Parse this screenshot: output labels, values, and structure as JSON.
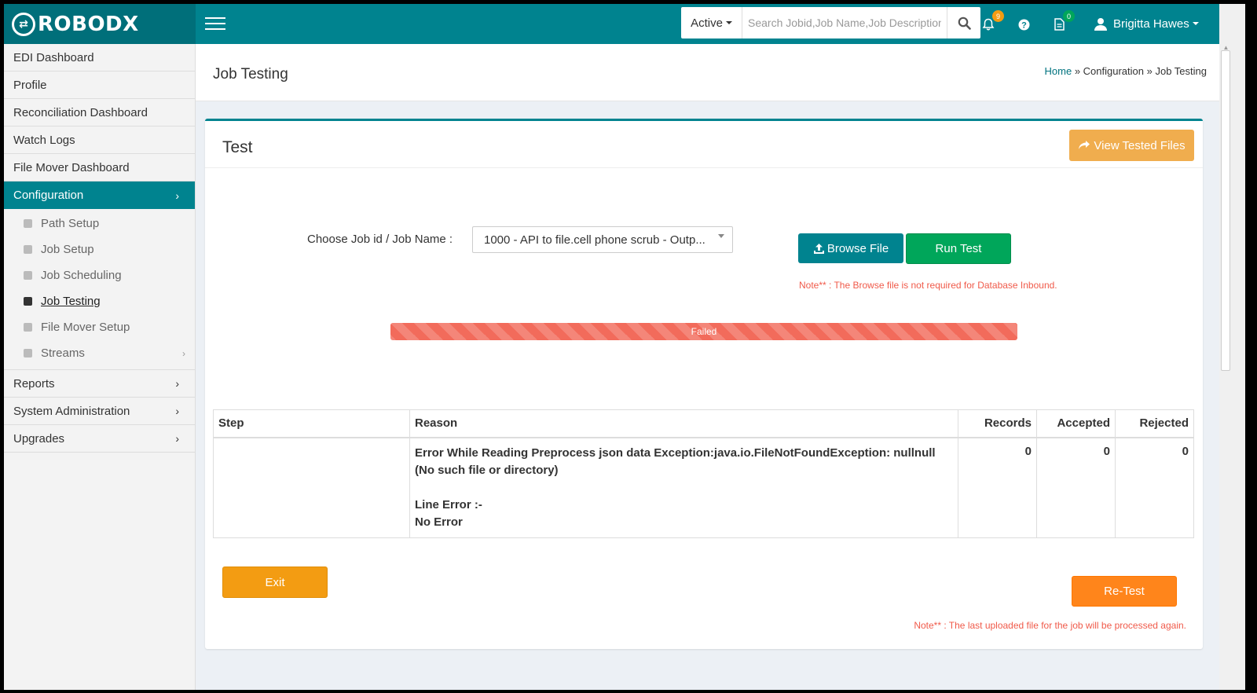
{
  "brand": {
    "logo_mark": "⇄",
    "name": "ROBODX"
  },
  "header": {
    "status_filter": "Active",
    "search_placeholder": "Search Jobid,Job Name,Job Description,U",
    "notifications_count": "9",
    "tasks_count": "0",
    "user_name": "Brigitta Hawes",
    "colors": {
      "header_bg": "#00838f",
      "logo_bg": "#006f7a",
      "notif_badge": "#f39c12",
      "task_badge": "#00a65a"
    }
  },
  "sidebar": {
    "items_top": [
      {
        "label": "EDI Dashboard"
      },
      {
        "label": "Profile"
      },
      {
        "label": "Reconciliation Dashboard"
      },
      {
        "label": "Watch Logs"
      },
      {
        "label": "File Mover Dashboard"
      }
    ],
    "configuration": {
      "label": "Configuration",
      "children": [
        {
          "label": "Path Setup"
        },
        {
          "label": "Job Setup"
        },
        {
          "label": "Job Scheduling"
        },
        {
          "label": "Job Testing"
        },
        {
          "label": "File Mover Setup"
        },
        {
          "label": "Streams"
        }
      ]
    },
    "items_bottom": [
      {
        "label": "Reports"
      },
      {
        "label": "System Administration"
      },
      {
        "label": "Upgrades"
      }
    ]
  },
  "page": {
    "title": "Job Testing",
    "breadcrumb": {
      "home": "Home",
      "sep1": " » ",
      "section": "Configuration",
      "sep2": " » ",
      "current": "Job Testing"
    }
  },
  "box": {
    "title": "Test",
    "view_tested_files": "View Tested Files",
    "choose_label": "Choose Job id / Job Name :",
    "selected_job": "1000 - API to file.cell phone scrub - Outp...",
    "browse_file": "Browse File",
    "run_test": "Run Test",
    "note_browse": "Note** : The Browse file is not required for Database Inbound.",
    "progress": {
      "label": "Failed",
      "percent": 100,
      "color": "#f26b5b"
    },
    "table": {
      "columns": [
        "Step",
        "Reason",
        "Records",
        "Accepted",
        "Rejected"
      ],
      "rows": [
        {
          "step": "",
          "reason_line1": "Error While Reading Preprocess json data Exception:java.io.FileNotFoundException: nullnull (No such file or directory)",
          "reason_line2": "Line Error :-",
          "reason_line3": "No Error",
          "records": "0",
          "accepted": "0",
          "rejected": "0"
        }
      ]
    },
    "exit": "Exit",
    "retest": "Re-Test",
    "note_retest": "Note** : The last uploaded file for the job will be processed again."
  }
}
